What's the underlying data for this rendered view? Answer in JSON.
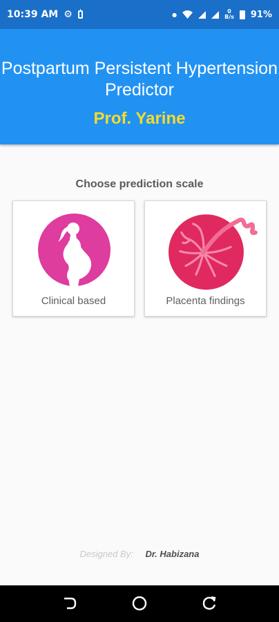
{
  "status_bar": {
    "time": "10:39 AM",
    "net_speed_value": "0",
    "net_speed_unit": "B/s",
    "battery": "91%",
    "icons": [
      "gear-icon",
      "battery-saver-icon",
      "dot-icon",
      "wifi-icon",
      "signal-icon",
      "signal-icon",
      "battery-icon"
    ]
  },
  "header": {
    "title": "Postpartum Persistent Hypertension Predictor",
    "subtitle": "Prof. Yarine",
    "background_color": "#2292f2",
    "subtitle_color": "#f4dc2c"
  },
  "main": {
    "prompt": "Choose prediction scale",
    "options": [
      {
        "label": "Clinical based",
        "icon": "pregnant-woman-icon",
        "icon_color": "#de3c9e"
      },
      {
        "label": "Placenta findings",
        "icon": "placenta-icon",
        "icon_color": "#e0295f"
      }
    ]
  },
  "footer": {
    "label": "Designed By:",
    "author": "Dr. Habizana"
  },
  "nav_bar": {
    "icons": [
      "back-icon",
      "home-icon",
      "recents-icon"
    ]
  }
}
